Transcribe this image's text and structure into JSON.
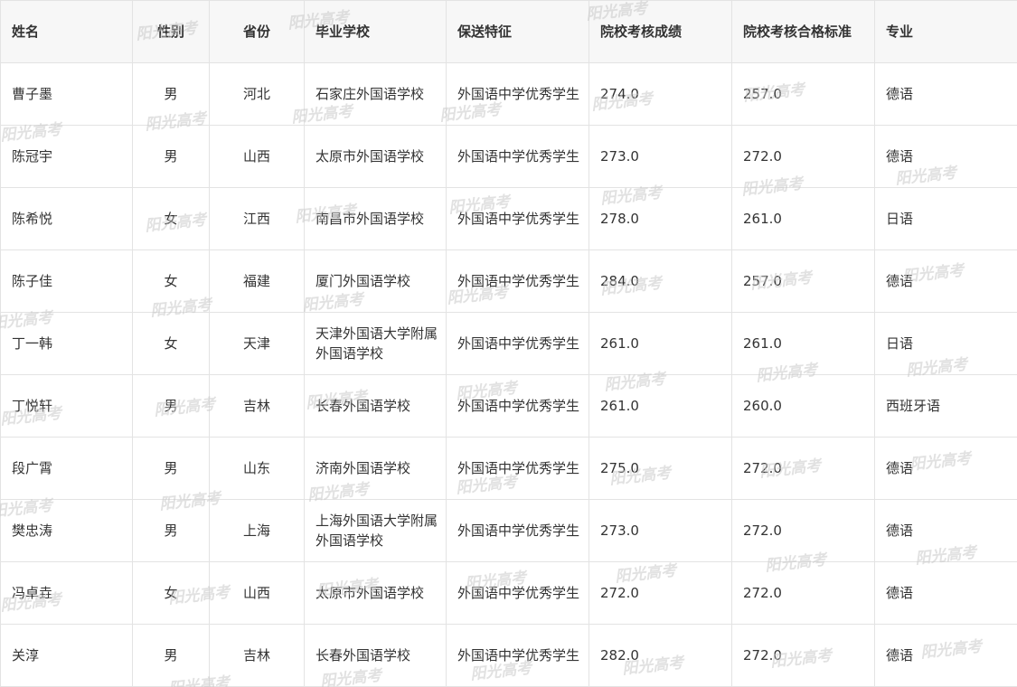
{
  "table": {
    "headers": [
      "姓名",
      "性别",
      "省份",
      "毕业学校",
      "保送特征",
      "院校考核成绩",
      "院校考核合格标准",
      "专业"
    ],
    "rows": [
      [
        "曹子墨",
        "男",
        "河北",
        "石家庄外国语学校",
        "外国语中学优秀学生",
        "274.0",
        "257.0",
        "德语"
      ],
      [
        "陈冠宇",
        "男",
        "山西",
        "太原市外国语学校",
        "外国语中学优秀学生",
        "273.0",
        "272.0",
        "德语"
      ],
      [
        "陈希悦",
        "女",
        "江西",
        "南昌市外国语学校",
        "外国语中学优秀学生",
        "278.0",
        "261.0",
        "日语"
      ],
      [
        "陈子佳",
        "女",
        "福建",
        "厦门外国语学校",
        "外国语中学优秀学生",
        "284.0",
        "257.0",
        "德语"
      ],
      [
        "丁一韩",
        "女",
        "天津",
        "天津外国语大学附属外国语学校",
        "外国语中学优秀学生",
        "261.0",
        "261.0",
        "日语"
      ],
      [
        "丁悦轩",
        "男",
        "吉林",
        "长春外国语学校",
        "外国语中学优秀学生",
        "261.0",
        "260.0",
        "西班牙语"
      ],
      [
        "段广霄",
        "男",
        "山东",
        "济南外国语学校",
        "外国语中学优秀学生",
        "275.0",
        "272.0",
        "德语"
      ],
      [
        "樊忠涛",
        "男",
        "上海",
        "上海外国语大学附属外国语学校",
        "外国语中学优秀学生",
        "273.0",
        "272.0",
        "德语"
      ],
      [
        "冯卓垚",
        "女",
        "山西",
        "太原市外国语学校",
        "外国语中学优秀学生",
        "272.0",
        "272.0",
        "德语"
      ],
      [
        "关淳",
        "男",
        "吉林",
        "长春外国语学校",
        "外国语中学优秀学生",
        "282.0",
        "272.0",
        "德语"
      ]
    ]
  },
  "watermark": {
    "text": "阳光高考"
  }
}
